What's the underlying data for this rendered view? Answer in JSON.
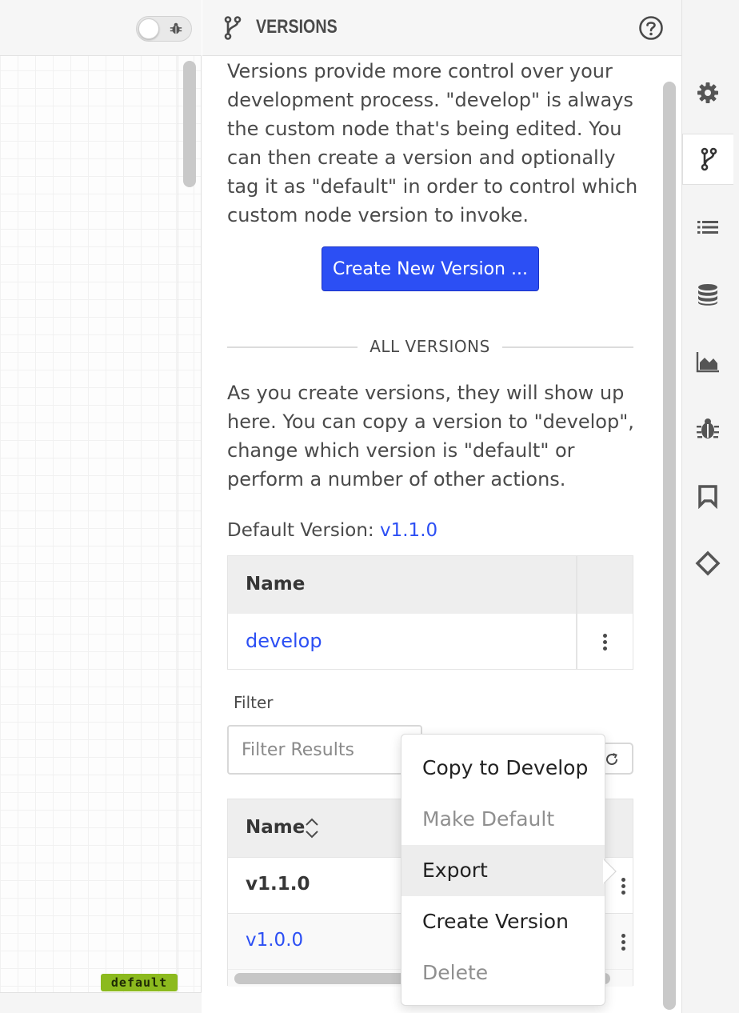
{
  "canvas": {
    "badge": "default"
  },
  "panel": {
    "title": "VERSIONS",
    "intro": "Versions provide more control over your development process. \"develop\" is always the custom node that's being edited. You can then create a version and optionally tag it as \"default\" in order to control which custom node version to invoke.",
    "create_button": "Create New Version ...",
    "section_label": "ALL VERSIONS",
    "versions_help": "As you create versions, they will show up here. You can copy a version to \"develop\", change which version is \"default\" or perform a number of other actions.",
    "default_version_label": "Default Version:",
    "default_version_value": "v1.1.0",
    "develop_table": {
      "header_name": "Name",
      "rows": [
        {
          "name": "develop"
        }
      ]
    },
    "filter": {
      "label": "Filter",
      "placeholder": "Filter Results"
    },
    "versions_table": {
      "header_name": "Name",
      "rows": [
        {
          "name": "v1.1.0"
        },
        {
          "name": "v1.0.0"
        }
      ]
    }
  },
  "context_menu": {
    "items": [
      {
        "label": "Copy to Develop",
        "disabled": false
      },
      {
        "label": "Make Default",
        "disabled": true
      },
      {
        "label": "Export",
        "disabled": false,
        "highlighted": true
      },
      {
        "label": "Create Version",
        "disabled": false
      },
      {
        "label": "Delete",
        "disabled": true
      }
    ]
  },
  "sidebar": {
    "items": [
      {
        "icon": "gear-icon"
      },
      {
        "icon": "branch-icon",
        "active": true
      },
      {
        "icon": "list-icon"
      },
      {
        "icon": "database-icon"
      },
      {
        "icon": "chart-icon"
      },
      {
        "icon": "bug-icon"
      },
      {
        "icon": "bookmark-icon"
      },
      {
        "icon": "code-icon"
      }
    ]
  },
  "colors": {
    "accent": "#2c4ff4",
    "badge": "#8cba1e"
  }
}
